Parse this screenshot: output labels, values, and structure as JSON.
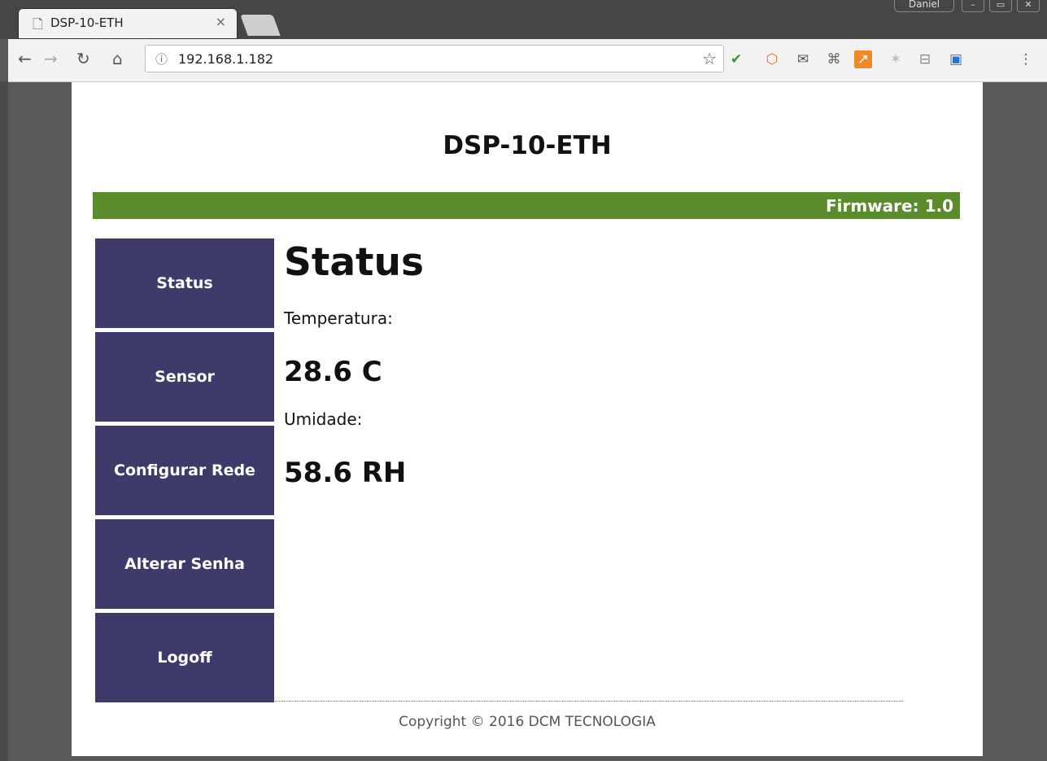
{
  "browser": {
    "tab_title": "DSP-10-ETH",
    "tab_close": "×",
    "profile": "Daniel",
    "url": "192.168.1.182"
  },
  "header": {
    "title": "DSP-10-ETH",
    "firmware": "Firmware: 1.0"
  },
  "menu": {
    "items": [
      {
        "label": "Status"
      },
      {
        "label": "Sensor"
      },
      {
        "label": "Configurar Rede"
      },
      {
        "label": "Alterar Senha"
      },
      {
        "label": "Logoff"
      }
    ]
  },
  "main": {
    "title": "Status",
    "temperature_label": "Temperatura:",
    "temperature_value": "28.6 C",
    "humidity_label": "Umidade:",
    "humidity_value": "58.6 RH"
  },
  "footer": {
    "copyright": "Copyright © 2016 DCM TECNOLOGIA"
  },
  "colors": {
    "accent_green": "#5a8c2d",
    "menu_bg": "#3e3a6a"
  }
}
